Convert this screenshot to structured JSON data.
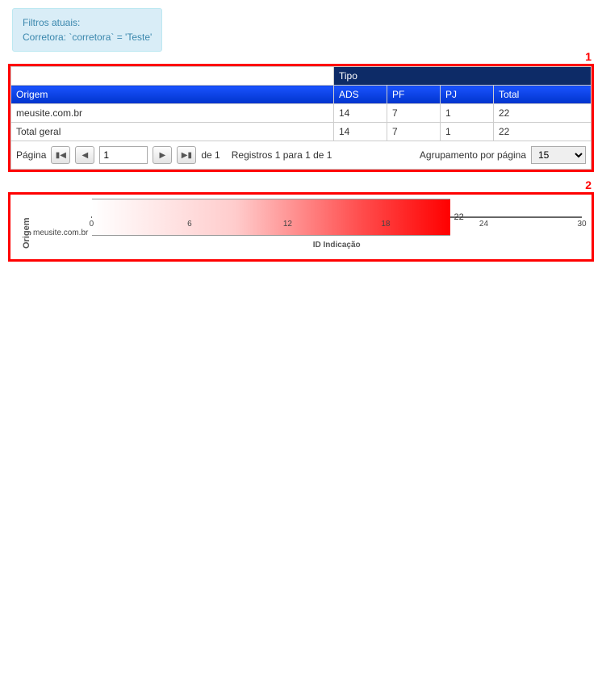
{
  "filter": {
    "title": "Filtros atuais:",
    "line": "Corretora: `corretora` = 'Teste'"
  },
  "annotations": {
    "box1": "1",
    "box2": "2"
  },
  "table": {
    "tipo_header": "Tipo",
    "col_origem": "Origem",
    "col_ads": "ADS",
    "col_pf": "PF",
    "col_pj": "PJ",
    "col_total": "Total",
    "rows": [
      {
        "origem": "meusite.com.br",
        "ads": "14",
        "pf": "7",
        "pj": "1",
        "total": "22"
      },
      {
        "origem": "Total geral",
        "ads": "14",
        "pf": "7",
        "pj": "1",
        "total": "22"
      }
    ]
  },
  "pager": {
    "pagina": "Página",
    "page_value": "1",
    "de": "de 1",
    "registros": "Registros 1 para 1 de 1",
    "agrupamento": "Agrupamento por página",
    "per_page": "15"
  },
  "chart_data": {
    "type": "bar",
    "orientation": "horizontal",
    "title": "Origem",
    "ylabel": "Origem",
    "xlabel": "ID Indicação",
    "xlim": [
      0,
      30
    ],
    "xticks": [
      0,
      6,
      12,
      18,
      24,
      30
    ],
    "categories": [
      "meusite.com.br"
    ],
    "values": [
      22
    ]
  }
}
